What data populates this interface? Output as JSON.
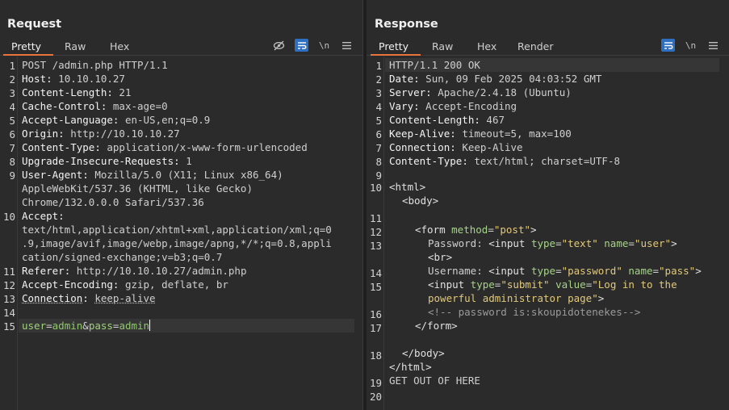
{
  "request": {
    "title": "Request",
    "tabs": [
      "Pretty",
      "Raw",
      "Hex"
    ],
    "tool_newline": "\\n",
    "lines": [
      {
        "num": "1",
        "key": "",
        "sep": "",
        "val": "POST /admin.php HTTP/1.1"
      },
      {
        "num": "2",
        "key": "Host",
        "sep": ": ",
        "val": "10.10.10.27"
      },
      {
        "num": "3",
        "key": "Content-Length",
        "sep": ": ",
        "val": "21"
      },
      {
        "num": "4",
        "key": "Cache-Control",
        "sep": ": ",
        "val": "max-age=0"
      },
      {
        "num": "5",
        "key": "Accept-Language",
        "sep": ": ",
        "val": "en-US,en;q=0.9"
      },
      {
        "num": "6",
        "key": "Origin",
        "sep": ": ",
        "val": "http://10.10.10.27"
      },
      {
        "num": "7",
        "key": "Content-Type",
        "sep": ": ",
        "val": "application/x-www-form-urlencoded"
      },
      {
        "num": "8",
        "key": "Upgrade-Insecure-Requests",
        "sep": ": ",
        "val": "1"
      },
      {
        "num": "9",
        "key": "User-Agent",
        "sep": ": ",
        "val": "Mozilla/5.0 (X11; Linux x86_64)"
      },
      {
        "num": "",
        "key": "",
        "sep": "",
        "val": "AppleWebKit/537.36 (KHTML, like Gecko)"
      },
      {
        "num": "",
        "key": "",
        "sep": "",
        "val": "Chrome/132.0.0.0 Safari/537.36"
      },
      {
        "num": "10",
        "key": "Accept",
        "sep": ":",
        "val": ""
      },
      {
        "num": "",
        "key": "",
        "sep": "",
        "val": "text/html,application/xhtml+xml,application/xml;q=0"
      },
      {
        "num": "",
        "key": "",
        "sep": "",
        "val": ".9,image/avif,image/webp,image/apng,*/*;q=0.8,appli"
      },
      {
        "num": "",
        "key": "",
        "sep": "",
        "val": "cation/signed-exchange;v=b3;q=0.7"
      },
      {
        "num": "11",
        "key": "Referer",
        "sep": ": ",
        "val": "http://10.10.10.27/admin.php"
      },
      {
        "num": "12",
        "key": "Accept-Encoding",
        "sep": ": ",
        "val": "gzip, deflate, br"
      },
      {
        "num": "13",
        "key": "Connection",
        "sep": ": ",
        "val": "keep-alive"
      },
      {
        "num": "14",
        "key": "",
        "sep": "",
        "val": ""
      }
    ],
    "body_line_num": "15",
    "body": {
      "k1": "user",
      "v1": "admin",
      "amp": "&",
      "k2": "pass",
      "v2": "admin",
      "eq": "="
    }
  },
  "response": {
    "title": "Response",
    "tabs": [
      "Pretty",
      "Raw",
      "Hex",
      "Render"
    ],
    "tool_newline": "\\n",
    "lines": [
      {
        "num": "1",
        "key": "",
        "sep": "",
        "val": "HTTP/1.1 200 OK"
      },
      {
        "num": "2",
        "key": "Date",
        "sep": ": ",
        "val": "Sun, 09 Feb 2025 04:03:52 GMT"
      },
      {
        "num": "3",
        "key": "Server",
        "sep": ": ",
        "val": "Apache/2.4.18 (Ubuntu)"
      },
      {
        "num": "4",
        "key": "Vary",
        "sep": ": ",
        "val": "Accept-Encoding"
      },
      {
        "num": "5",
        "key": "Content-Length",
        "sep": ": ",
        "val": "467"
      },
      {
        "num": "6",
        "key": "Keep-Alive",
        "sep": ": ",
        "val": "timeout=5, max=100"
      },
      {
        "num": "7",
        "key": "Connection",
        "sep": ": ",
        "val": "Keep-Alive"
      },
      {
        "num": "8",
        "key": "Content-Type",
        "sep": ": ",
        "val": "text/html; charset=UTF-8"
      },
      {
        "num": "9",
        "key": "",
        "sep": "",
        "val": ""
      }
    ],
    "html": {
      "l10_num": "10",
      "html_open": "<html>",
      "body_open": "<body>",
      "l11_num": "11",
      "l12_num": "12",
      "form_lt": "<form ",
      "form_attr": "method",
      "form_eq": "=",
      "form_val": "\"post\"",
      "form_gt": ">",
      "l13_num": "13",
      "pw_label": "Password: ",
      "in_lt": "<input ",
      "a_type": "type",
      "eq": "=",
      "v_text": "\"text\"",
      "a_name": "name",
      "v_user": "\"user\"",
      "gt": ">",
      "l14_br": "<br>",
      "l14_num": "14",
      "un_label": "Username: ",
      "v_password": "\"password\"",
      "v_pass": "\"pass\"",
      "l15_num": "15",
      "a_value": "value",
      "v_submit": "\"submit\"",
      "v_login1": "\"Log in to the",
      "v_login2": "powerful administrator page\"",
      "l16_num": "16",
      "comment": "<!-- password is:skoupidotenekes-->",
      "l17_num": "17",
      "form_close": "</form>",
      "l18_num": "18",
      "body_close": "</body>",
      "html_close": "</html>",
      "l19_num": "19",
      "get_out": "GET OUT OF HERE",
      "l20_num": "20"
    }
  }
}
